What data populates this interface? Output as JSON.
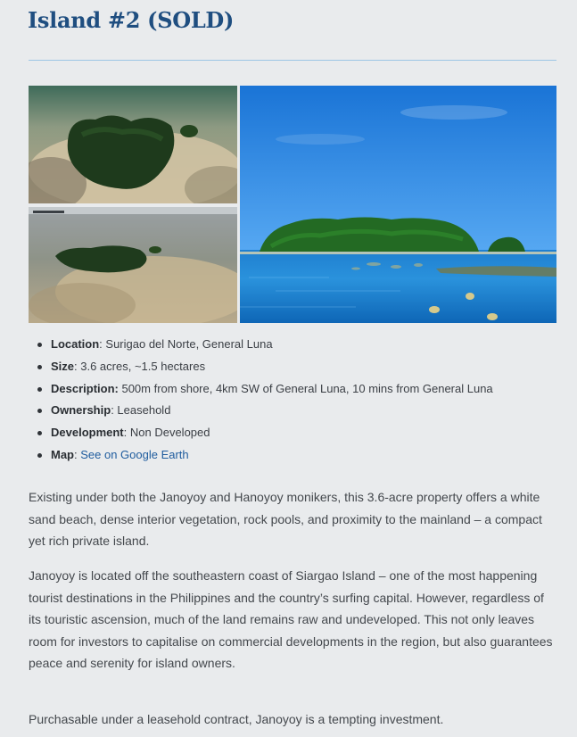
{
  "page": {
    "title": "Island #2 (SOLD)"
  },
  "gallery": {
    "images": [
      {
        "icon": "aerial-island-photo-1"
      },
      {
        "icon": "aerial-island-photo-2"
      },
      {
        "icon": "island-seascape-photo"
      }
    ]
  },
  "details": {
    "location": {
      "label": "Location",
      "sep": ": ",
      "value": "Surigao del Norte, General Luna"
    },
    "size": {
      "label": "Size",
      "sep": ": ",
      "value": "3.6 acres, ~1.5 hectares"
    },
    "description": {
      "label": "Description:",
      "sep": " ",
      "value": "500m from shore, 4km SW of General Luna, 10 mins from General Luna"
    },
    "ownership": {
      "label": "Ownership",
      "sep": ": ",
      "value": "Leasehold"
    },
    "development": {
      "label": "Development",
      "sep": ": ",
      "value": "Non Developed"
    },
    "map": {
      "label": "Map",
      "sep": ": ",
      "link": "See on Google Earth"
    }
  },
  "body": {
    "p1": "Existing under both the Janoyoy and Hanoyoy monikers, this 3.6-acre property offers a white sand beach, dense interior vegetation, rock pools, and proximity to the mainland – a compact yet rich private island.",
    "p2": "Janoyoy is located off the southeastern coast of Siargao Island – one of the most happening tourist destinations in the Philippines and the country’s surfing capital. However, regardless of its touristic ascension, much of the land remains raw and undeveloped. This not only leaves room for investors to capitalise on commercial developments in the region, but also guarantees peace and serenity for island owners.",
    "p3": "Purchasable under a leasehold contract, Janoyoy is a tempting investment."
  },
  "colors": {
    "title": "#1f4e80",
    "link": "#1f5c9e",
    "divider": "#9dc6e5",
    "background": "#e9ebed"
  }
}
